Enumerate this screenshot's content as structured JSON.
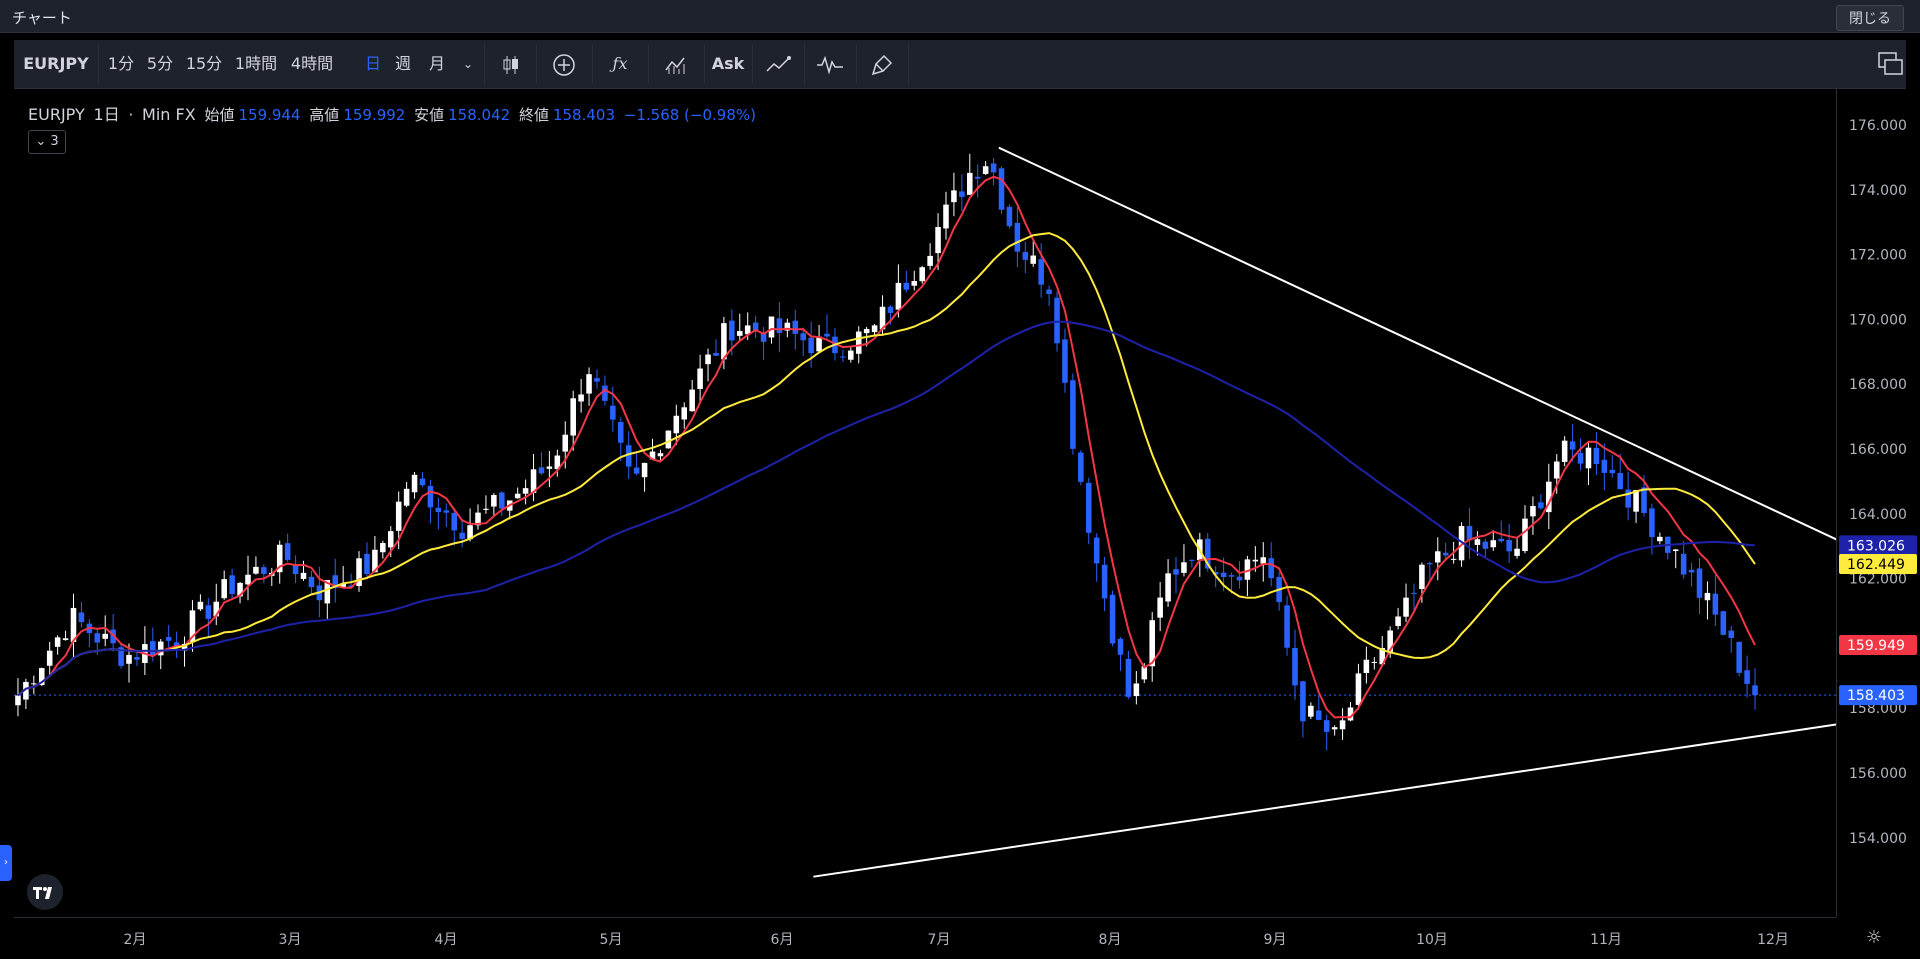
{
  "window": {
    "title": "チャート",
    "close_label": "閉じる"
  },
  "toolbar": {
    "symbol": "EURJPY",
    "intervals": [
      "1分",
      "5分",
      "15分",
      "1時間",
      "4時間",
      "日",
      "週",
      "月"
    ],
    "active_interval": "日",
    "ask_label": "Ask"
  },
  "legend": {
    "symbol": "EURJPY",
    "interval": "1日",
    "source": "Min FX",
    "open_label": "始値",
    "open": "159.944",
    "high_label": "高値",
    "high": "159.992",
    "low_label": "安値",
    "low": "158.042",
    "close_label": "終値",
    "close": "158.403",
    "change": "−1.568 (−0.98%)",
    "indicator_toggle": "3"
  },
  "price_axis": {
    "ticks": [
      "176.000",
      "174.000",
      "172.000",
      "170.000",
      "168.000",
      "166.000",
      "164.000",
      "162.000",
      "160.000",
      "158.000",
      "156.000",
      "154.000"
    ],
    "badges": [
      {
        "label": "163.026",
        "value": 163.026,
        "color": "#1e22aa"
      },
      {
        "label": "162.449",
        "value": 162.449,
        "color": "#ffeb3b"
      },
      {
        "label": "159.949",
        "value": 159.949,
        "color": "#f23645"
      },
      {
        "label": "158.403",
        "value": 158.403,
        "color": "#2962ff"
      }
    ]
  },
  "time_axis": {
    "labels": [
      "2月",
      "3月",
      "4月",
      "5月",
      "6月",
      "7月",
      "8月",
      "9月",
      "10月",
      "11月",
      "12月"
    ]
  },
  "colors": {
    "up": "#ffffff",
    "down": "#2962ff",
    "ma_fast": "#f23645",
    "ma_mid": "#ffeb3b",
    "ma_slow": "#1e22aa",
    "trendline": "#ffffff"
  },
  "chart_data": {
    "type": "candlestick",
    "ylim": [
      153,
      177
    ],
    "months": [
      "2月",
      "3月",
      "4月",
      "5月",
      "6月",
      "7月",
      "8月",
      "9月",
      "10月",
      "11月",
      "12月"
    ],
    "close_path": [
      {
        "t": 0,
        "v": 158.4
      },
      {
        "t": 0.03,
        "v": 160.8
      },
      {
        "t": 0.06,
        "v": 159.6
      },
      {
        "t": 0.09,
        "v": 160.2
      },
      {
        "t": 0.12,
        "v": 161.8
      },
      {
        "t": 0.15,
        "v": 162.7
      },
      {
        "t": 0.17,
        "v": 161.6
      },
      {
        "t": 0.2,
        "v": 162.5
      },
      {
        "t": 0.22,
        "v": 165.1
      },
      {
        "t": 0.25,
        "v": 163.6
      },
      {
        "t": 0.28,
        "v": 164.6
      },
      {
        "t": 0.3,
        "v": 165.6
      },
      {
        "t": 0.32,
        "v": 168.6
      },
      {
        "t": 0.345,
        "v": 164.8
      },
      {
        "t": 0.37,
        "v": 167.2
      },
      {
        "t": 0.4,
        "v": 169.8
      },
      {
        "t": 0.43,
        "v": 169.6
      },
      {
        "t": 0.455,
        "v": 169.1
      },
      {
        "t": 0.48,
        "v": 169.6
      },
      {
        "t": 0.51,
        "v": 172.2
      },
      {
        "t": 0.535,
        "v": 174.6
      },
      {
        "t": 0.545,
        "v": 175.0
      },
      {
        "t": 0.56,
        "v": 172.4
      },
      {
        "t": 0.58,
        "v": 171.0
      },
      {
        "t": 0.59,
        "v": 167.0
      },
      {
        "t": 0.605,
        "v": 162.6
      },
      {
        "t": 0.625,
        "v": 158.0
      },
      {
        "t": 0.645,
        "v": 162.0
      },
      {
        "t": 0.66,
        "v": 163.0
      },
      {
        "t": 0.68,
        "v": 162.2
      },
      {
        "t": 0.7,
        "v": 162.8
      },
      {
        "t": 0.72,
        "v": 158.0
      },
      {
        "t": 0.74,
        "v": 157.0
      },
      {
        "t": 0.755,
        "v": 159.0
      },
      {
        "t": 0.775,
        "v": 160.6
      },
      {
        "t": 0.79,
        "v": 162.2
      },
      {
        "t": 0.81,
        "v": 163.2
      },
      {
        "t": 0.84,
        "v": 162.8
      },
      {
        "t": 0.865,
        "v": 165.8
      },
      {
        "t": 0.885,
        "v": 165.9
      },
      {
        "t": 0.91,
        "v": 164.2
      },
      {
        "t": 0.93,
        "v": 162.8
      },
      {
        "t": 0.955,
        "v": 160.6
      },
      {
        "t": 0.975,
        "v": 158.4
      }
    ],
    "moving_averages": [
      {
        "name": "",
        "color": "#f23645",
        "last": 159.949
      },
      {
        "name": "",
        "color": "#ffeb3b",
        "last": 162.449
      },
      {
        "name": "",
        "color": "#1e22aa",
        "last": 163.026
      }
    ],
    "trendlines": [
      {
        "from": {
          "month_index": 5.35,
          "price": 175.3
        },
        "to": {
          "month_index": 10.4,
          "price": 163.2
        }
      },
      {
        "from": {
          "month_index": 4.2,
          "price": 152.8
        },
        "to": {
          "month_index": 10.4,
          "price": 157.5
        }
      }
    ]
  }
}
